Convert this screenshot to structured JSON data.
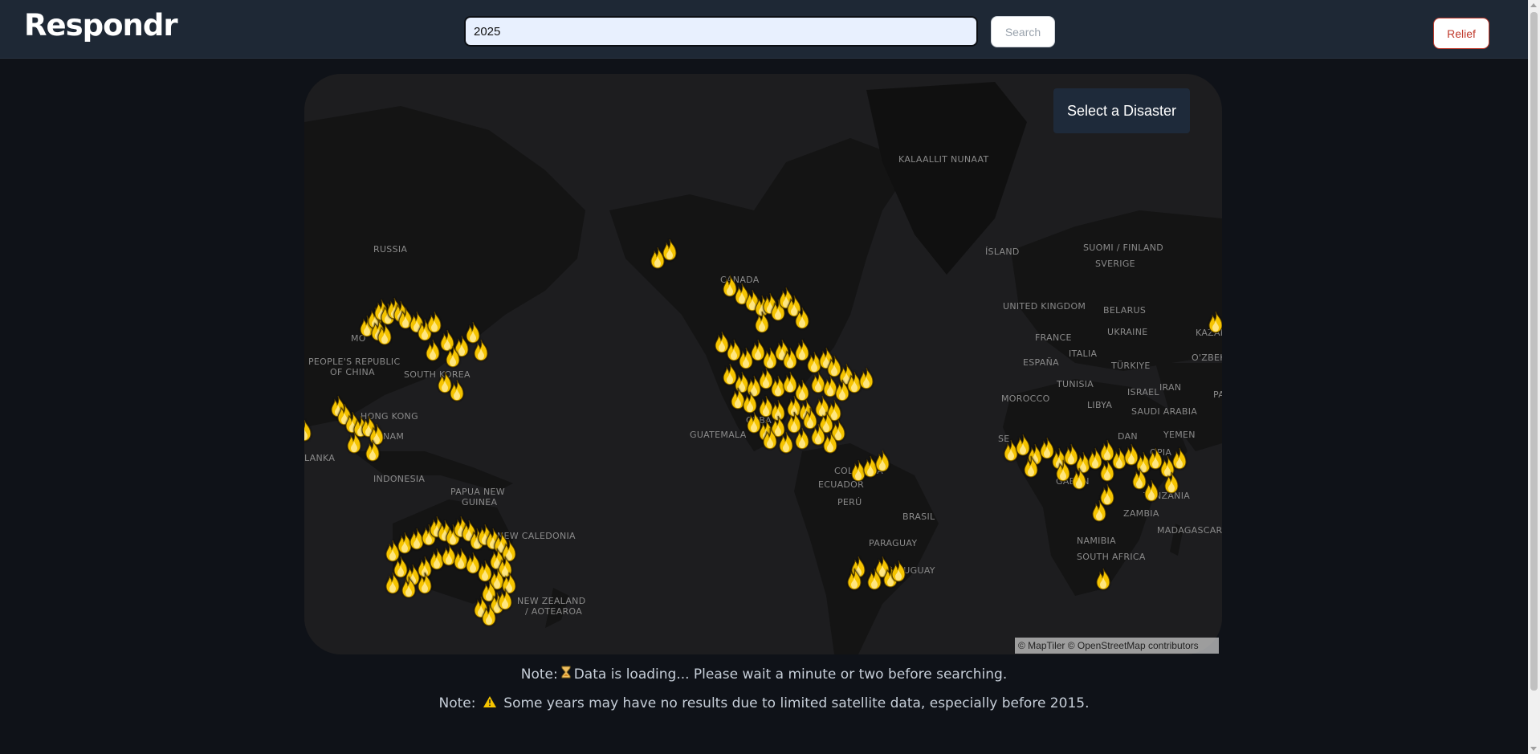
{
  "header": {
    "logo": "Respondr",
    "search_value": "2025",
    "search_button": "Search",
    "relief_button": "Relief"
  },
  "map": {
    "select_label": "Select a Disaster",
    "attribution": "© MapTiler © OpenStreetMap contributors",
    "marker_icon": "fire-icon",
    "marker_color": "#f5c400",
    "labels": {
      "kalaallit": "KALAALLIT NUNAAT",
      "russia": "RUSSIA",
      "canada": "CANADA",
      "island": "ÍSLAND",
      "suomi": "SUOMI / FINLAND",
      "sverige": "SVERIGE",
      "uk": "UNITED KINGDOM",
      "belarus": "BELARUS",
      "ukraine": "UKRAINE",
      "france": "FRANCE",
      "espana": "ESPAÑA",
      "italia": "ITALIA",
      "turkiye": "TÜRKIYE",
      "kazak": "KAZAK",
      "ozbek": "O'ZBEKI",
      "morocco": "MOROCCO",
      "tunisia": "TUNISIA",
      "libya": "LIBYA",
      "israel": "ISRAEL",
      "iran": "IRAN",
      "saudi": "SAUDI ARABIA",
      "yemen": "YEMEN",
      "pa": "PA",
      "mongolia": "MO",
      "prc1": "PEOPLE'S REPUBLIC",
      "prc2": "OF CHINA",
      "southkorea": "SOUTH KOREA",
      "hongkong": "HONG KONG",
      "nam": "NAM",
      "lanka": "LANKA",
      "indonesia": "INDONESIA",
      "png1": "PAPUA NEW",
      "png2": "GUINEA",
      "newcal": "NEW CALEDONIA",
      "nz1": "NEW ZEALAND",
      "nz2": "/ AOTEAROA",
      "guatemala": "GUATEMALA",
      "cuba": "CUBA",
      "colombia": "COLOMBIA",
      "ecuador": "ECUADOR",
      "peru": "PERÚ",
      "brasil": "BRASIL",
      "paraguay": "PARAGUAY",
      "uruguay": "URUGUAY",
      "gabon": "GABON",
      "tanzania": "TANZANIA",
      "zambia": "ZAMBIA",
      "namibia": "NAMIBIA",
      "southafrica": "SOUTH AFRICA",
      "madagascar": "MADAGASCAR",
      "dan": "DAN",
      "opia": "OPIA",
      "se": "SE"
    }
  },
  "notes": {
    "note_label": "Note:",
    "loading_icon": "hourglass-icon",
    "loading_text": "Data is loading... Please wait a minute or two before searching.",
    "warning_icon": "warning-icon",
    "warning_text": "Some years may have no results due to limited satellite data, especially before 2015."
  }
}
